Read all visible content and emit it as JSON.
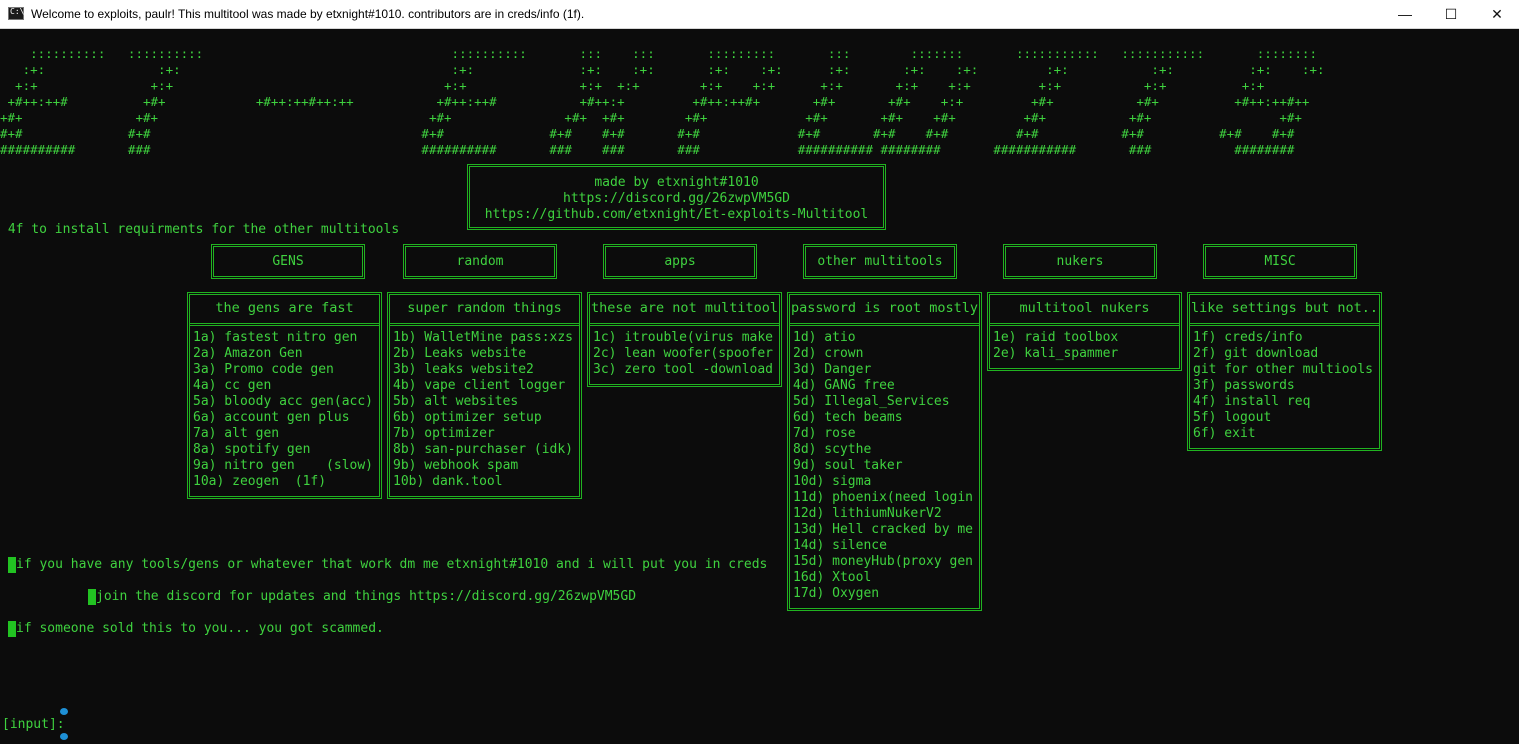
{
  "window": {
    "title": "Welcome to exploits, paulr! This multitool was made by etxnight#1010. contributors are in creds/info (1f).",
    "minimize_glyph": "—",
    "maximize_glyph": "☐",
    "close_glyph": "✕"
  },
  "banner": {
    "lines": [
      "    ::::::::::   ::::::::::                                 ::::::::::       :::    :::       :::::::::       :::        :::::::       :::::::::::   :::::::::::       ::::::::",
      "   :+:               :+:                                    :+:              :+:    :+:       :+:    :+:      :+:       :+:    :+:         :+:           :+:          :+:    :+:",
      "  +:+               +:+                                    +:+               +:+  +:+        +:+    +:+      +:+       +:+    +:+         +:+           +:+          +:+",
      " +#++:++#          +#+            +#++:++#++:++           +#++:++#           +#++:+         +#++:++#+       +#+       +#+    +:+         +#+           +#+          +#++:++#++",
      "+#+               +#+                                    +#+               +#+  +#+        +#+             +#+       +#+    +#+         +#+           +#+                 +#+",
      "#+#              #+#                                    #+#              #+#    #+#       #+#             #+#       #+#    #+#         #+#           #+#          #+#    #+#",
      "##########       ###                                    ##########       ###    ###       ###             ########## ########       ###########       ###           ########"
    ]
  },
  "info_box": {
    "line1": "made by etxnight#1010",
    "line2": "https://discord.gg/26zwpVM5GD",
    "line3": "https://github.com/etxnight/Et-exploits-Multitool"
  },
  "install_hint": " 4f to install requirments for the other multitools",
  "categories": [
    {
      "label": "GENS"
    },
    {
      "label": "random"
    },
    {
      "label": "apps"
    },
    {
      "label": "other multitools"
    },
    {
      "label": "nukers"
    },
    {
      "label": "MISC"
    }
  ],
  "panels": [
    {
      "header": "the gens are fast",
      "items": [
        "1a) fastest nitro gen",
        "2a) Amazon Gen",
        "3a) Promo code gen",
        "4a) cc gen",
        "5a) bloody acc gen(acc)",
        "6a) account gen plus",
        "7a) alt gen",
        "8a) spotify gen",
        "9a) nitro gen    (slow)",
        "10a) zeogen  (1f)"
      ]
    },
    {
      "header": "super random things",
      "items": [
        "1b) WalletMine pass:xzs",
        "2b) Leaks website",
        "3b) leaks website2",
        "4b) vape client logger",
        "5b) alt websites",
        "6b) optimizer setup",
        "7b) optimizer",
        "8b) san-purchaser (idk)",
        "9b) webhook spam",
        "10b) dank.tool"
      ]
    },
    {
      "header": "these are not multitool",
      "items": [
        "1c) itrouble(virus make",
        "2c) lean woofer(spoofer",
        "3c) zero tool -download"
      ]
    },
    {
      "header": "password is root mostly",
      "items": [
        "1d) atio",
        "2d) crown",
        "3d) Danger",
        "4d) GANG free",
        "5d) Illegal_Services",
        "6d) tech beams",
        "7d) rose",
        "8d) scythe",
        "9d) soul taker",
        "10d) sigma",
        "11d) phoenix(need login",
        "12d) lithiumNukerV2",
        "13d) Hell cracked by me",
        "14d) silence",
        "15d) moneyHub(proxy gen",
        "16d) Xtool",
        "17d) Oxygen"
      ]
    },
    {
      "header": "multitool nukers",
      "items": [
        "1e) raid toolbox",
        "2e) kali_spammer"
      ]
    },
    {
      "header": "like settings but not..",
      "items": [
        "1f) creds/info",
        "2f) git download",
        "git for other multiools",
        "3f) passwords",
        "4f) install req",
        "5f) logout",
        "6f) exit"
      ]
    }
  ],
  "messages": {
    "tools": "if you have any tools/gens or whatever that work dm me etxnight#1010 and i will put you in creds",
    "discord": "join the discord for updates and things https://discord.gg/26zwpVM5GD",
    "scam": "if someone sold this to you... you got scammed."
  },
  "prompt": "[input]:"
}
